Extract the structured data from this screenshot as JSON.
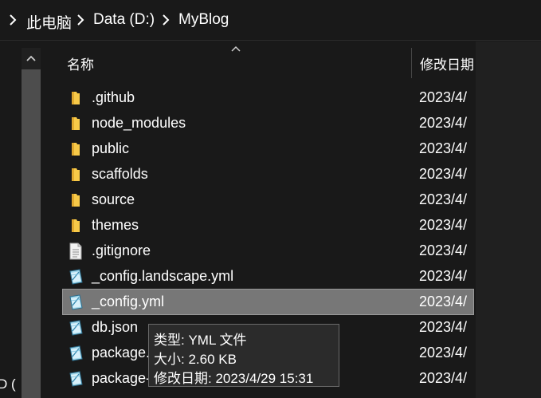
{
  "breadcrumb": {
    "items": [
      "此电脑",
      "Data (D:)",
      "MyBlog"
    ]
  },
  "nav": {
    "drive_label": "D ("
  },
  "columns": {
    "name": "名称",
    "date": "修改日期"
  },
  "files": [
    {
      "name": ".github",
      "date": "2023/4/",
      "type": "folder"
    },
    {
      "name": "node_modules",
      "date": "2023/4/",
      "type": "folder"
    },
    {
      "name": "public",
      "date": "2023/4/",
      "type": "folder"
    },
    {
      "name": "scaffolds",
      "date": "2023/4/",
      "type": "folder"
    },
    {
      "name": "source",
      "date": "2023/4/",
      "type": "folder"
    },
    {
      "name": "themes",
      "date": "2023/4/",
      "type": "folder"
    },
    {
      "name": ".gitignore",
      "date": "2023/4/",
      "type": "text-file"
    },
    {
      "name": "_config.landscape.yml",
      "date": "2023/4/",
      "type": "config-file"
    },
    {
      "name": "_config.yml",
      "date": "2023/4/",
      "type": "config-file",
      "selected": true
    },
    {
      "name": "db.json",
      "date": "2023/4/",
      "type": "config-file"
    },
    {
      "name": "package.json",
      "date": "2023/4/",
      "type": "config-file"
    },
    {
      "name": "package-lock.json",
      "date": "2023/4/",
      "type": "config-file"
    }
  ],
  "tooltip": {
    "type_line": "类型: YML 文件",
    "size_line": "大小: 2.60 KB",
    "date_line": "修改日期: 2023/4/29 15:31"
  },
  "colors": {
    "background": "#191919",
    "selection": "#777777",
    "folder": "#f7c948"
  }
}
